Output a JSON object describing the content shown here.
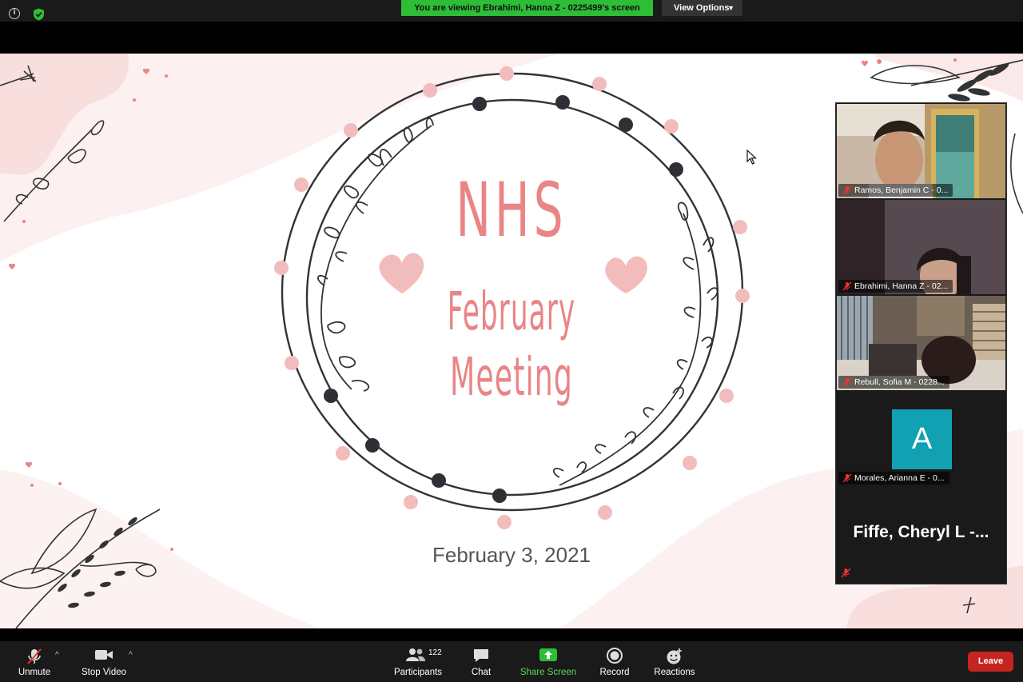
{
  "top_bar": {
    "viewing_banner": "You are viewing Ebrahimi, Hanna Z - 0225499's screen",
    "view_options_label": "View Options",
    "info_icon_glyph": "i"
  },
  "slide": {
    "title_line1": "NHS",
    "title_line2": "February",
    "title_line3": "Meeting",
    "date": "February 3, 2021",
    "accent_color": "#e98586"
  },
  "participants": [
    {
      "name": "Ramos, Benjamin C - 0...",
      "muted": true,
      "active": false
    },
    {
      "name": "Ebrahimi, Hanna Z - 02...",
      "muted": true,
      "active": true
    },
    {
      "name": "Rebull, Sofia M - 0228...",
      "muted": true,
      "active": false
    },
    {
      "name": "Morales, Arianna E - 0...",
      "muted": true,
      "active": false,
      "avatar_letter": "A"
    },
    {
      "name": "Fiffe, Cheryl L -...",
      "muted": true,
      "active": false
    }
  ],
  "toolbar": {
    "unmute_label": "Unmute",
    "stop_video_label": "Stop Video",
    "participants_label": "Participants",
    "participants_count": "122",
    "chat_label": "Chat",
    "share_screen_label": "Share Screen",
    "record_label": "Record",
    "reactions_label": "Reactions",
    "leave_label": "Leave",
    "caret_glyph": "^",
    "share_color": "#2ebd36",
    "leave_color": "#c42521"
  }
}
